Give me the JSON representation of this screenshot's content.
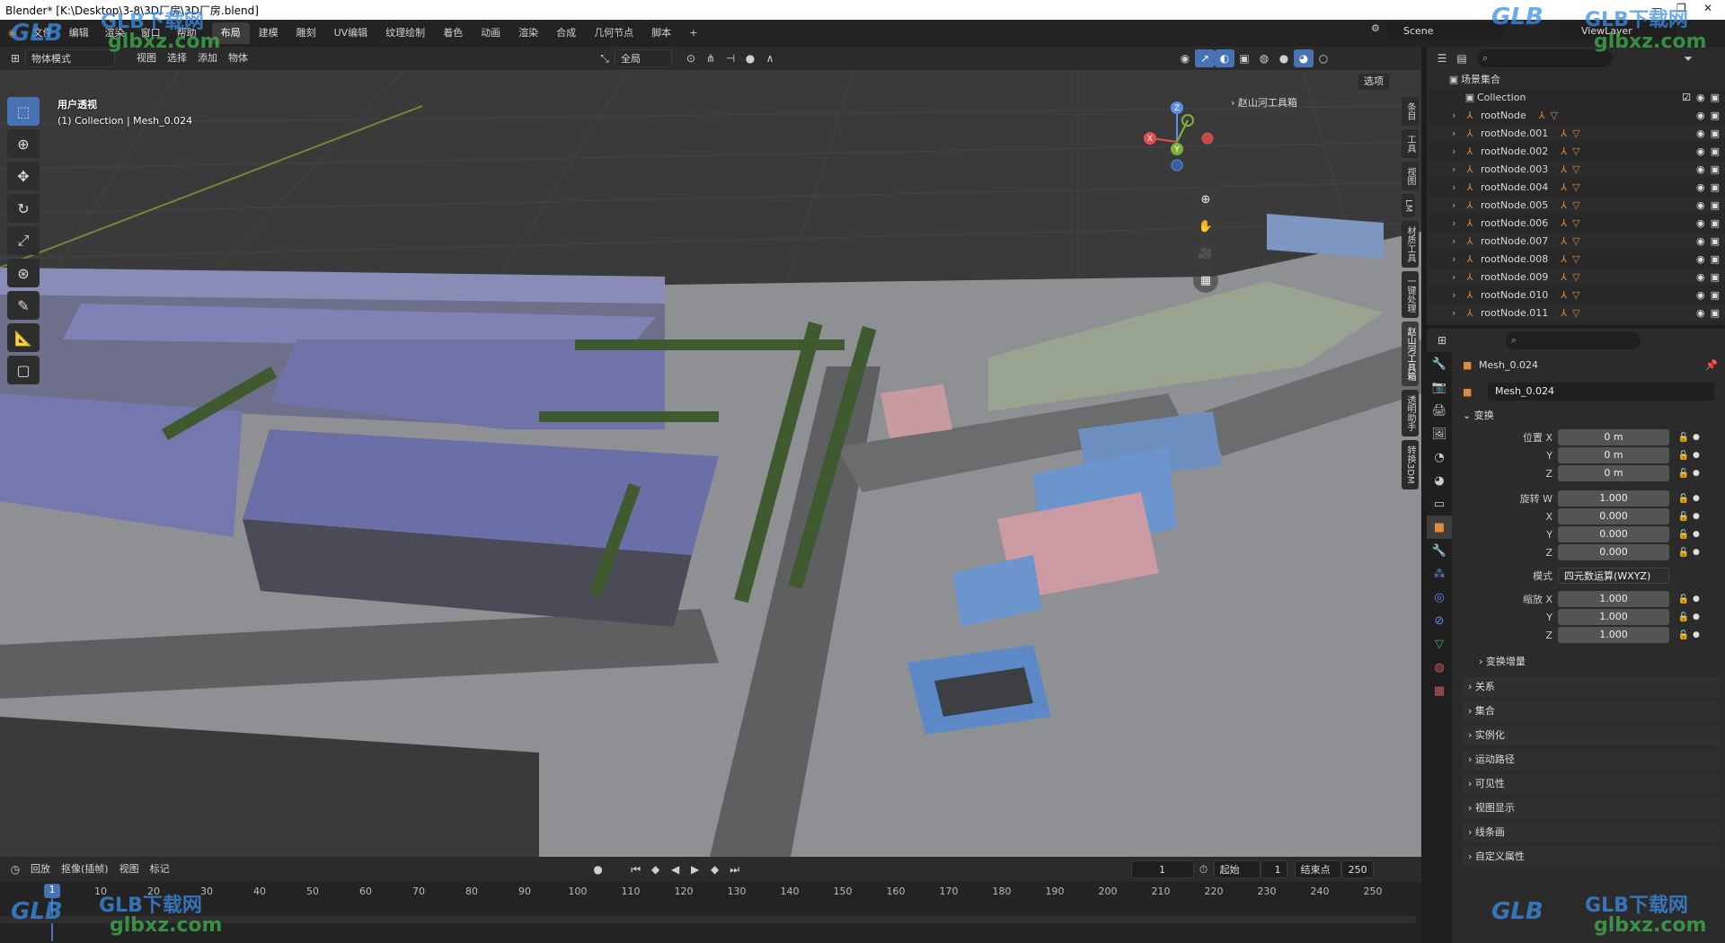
{
  "title_bar": {
    "title": "Blender* [K:\\Desktop\\3-8\\3D厂房\\3D厂房.blend]",
    "minimize": "—",
    "maximize": "❐",
    "close": "✕"
  },
  "menu": {
    "items": [
      "文件",
      "编辑",
      "渲染",
      "窗口",
      "帮助"
    ],
    "workspaces": [
      "布局",
      "建模",
      "雕刻",
      "UV编辑",
      "纹理绘制",
      "着色",
      "动画",
      "渲染",
      "合成",
      "几何节点",
      "脚本"
    ],
    "active_workspace": "布局",
    "add_tab": "+",
    "scene": "Scene",
    "view_layer": "ViewLayer"
  },
  "viewport_header": {
    "mode": "物体模式",
    "menus": [
      "视图",
      "选择",
      "添加",
      "物体"
    ],
    "orientation": "全局",
    "options": "选项"
  },
  "viewport": {
    "view_name": "用户透视",
    "collection_info": "(1) Collection | Mesh_0.024",
    "n_panel_label": "赵山河工具箱",
    "side_tabs": [
      "条目",
      "工具",
      "视图",
      "LM",
      "材质工具",
      "一键处理",
      "赵山河工具箱",
      "透明助手",
      "转换3DM"
    ],
    "active_side_tab": "赵山河工具箱",
    "gizmo": {
      "x": "X",
      "y": "Y",
      "z": "Z"
    }
  },
  "timeline": {
    "menus": [
      "回放",
      "抠像(插帧)",
      "视图",
      "标记"
    ],
    "current_frame": "1",
    "start_label": "起始",
    "start": "1",
    "end_label": "结束点",
    "end": "250",
    "playhead": "1",
    "ticks": [
      "10",
      "20",
      "30",
      "40",
      "50",
      "60",
      "70",
      "80",
      "90",
      "100",
      "110",
      "120",
      "130",
      "140",
      "150",
      "160",
      "170",
      "180",
      "190",
      "200",
      "210",
      "220",
      "230",
      "240",
      "250"
    ]
  },
  "outliner": {
    "scene_collection": "场景集合",
    "collection": "Collection",
    "rows": [
      "rootNode",
      "rootNode.001",
      "rootNode.002",
      "rootNode.003",
      "rootNode.004",
      "rootNode.005",
      "rootNode.006",
      "rootNode.007",
      "rootNode.008",
      "rootNode.009",
      "rootNode.010",
      "rootNode.011"
    ]
  },
  "properties": {
    "object_name": "Mesh_0.024",
    "datablock": "Mesh_0.024",
    "transform_label": "变换",
    "location_label": "位置 X",
    "location": {
      "x": "0 m",
      "y": "0 m",
      "z": "0 m"
    },
    "rotation_label": "旋转 W",
    "rotation": {
      "w": "1.000",
      "x": "0.000",
      "y": "0.000",
      "z": "0.000"
    },
    "mode_label": "模式",
    "mode_value": "四元数运算(WXYZ)",
    "scale_label": "缩放 X",
    "scale": {
      "x": "1.000",
      "y": "1.000",
      "z": "1.000"
    },
    "axis_y": "Y",
    "axis_z": "Z",
    "axis_x": "X",
    "delta_transform": "变换增量",
    "sections": [
      "关系",
      "集合",
      "实例化",
      "运动路径",
      "可见性",
      "视图显示",
      "线条画",
      "自定义属性"
    ]
  },
  "watermark": {
    "logo": "GLB",
    "cn": "GLB下载网",
    "url": "glbxz.com"
  }
}
